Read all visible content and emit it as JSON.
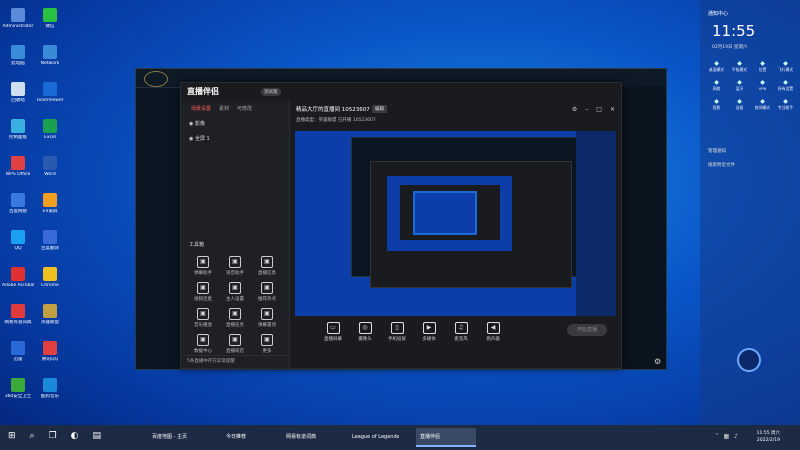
{
  "desktop_icons": [
    {
      "label": "Administrator",
      "color": "#5a8ad8"
    },
    {
      "label": "此电脑",
      "color": "#3a8cd8"
    },
    {
      "label": "回收站",
      "color": "#d0e0f0"
    },
    {
      "label": "控制面板",
      "color": "#3ab0e0"
    },
    {
      "label": "WPS Office",
      "color": "#e04040"
    },
    {
      "label": "百度网盘",
      "color": "#3a7ae0"
    },
    {
      "label": "QQ",
      "color": "#1aa0f0"
    },
    {
      "label": "Adobe Acrobat DC",
      "color": "#e03030"
    },
    {
      "label": "网易有道词典",
      "color": "#e03a3a"
    },
    {
      "label": "迅雷",
      "color": "#2a6ad8"
    },
    {
      "label": "360安全卫士",
      "color": "#3aaa3a"
    },
    {
      "label": "微信",
      "color": "#2ac040"
    },
    {
      "label": "Network",
      "color": "#3a8ad8"
    },
    {
      "label": "TeamViewer",
      "color": "#1a6ad8"
    },
    {
      "label": "Excel",
      "color": "#1aa050"
    },
    {
      "label": "Word",
      "color": "#2a5ab0"
    },
    {
      "label": "EV录屏",
      "color": "#f0a020"
    },
    {
      "label": "百度翻译",
      "color": "#3a6ad8"
    },
    {
      "label": "Chrome",
      "color": "#f0c020"
    },
    {
      "label": "英雄联盟",
      "color": "#c0a040"
    },
    {
      "label": "腾讯QQ",
      "color": "#e04040"
    },
    {
      "label": "酷狗音乐",
      "color": "#1a8ad8"
    }
  ],
  "live_window": {
    "app_name": "直播伴侣",
    "version": "测试版",
    "side_tabs": [
      "场景设置",
      "素材",
      "可修改"
    ],
    "scenes": [
      "影像",
      "全屏 1"
    ],
    "tools_title": "工具箱",
    "tools": [
      "弹幕助手",
      "语音助手",
      "直播信息",
      "视频连麦",
      "主人设置",
      "推荐热点",
      "音乐播放",
      "直播任务",
      "弹幕置顶",
      "数据中心",
      "直播商店",
      "更多"
    ],
    "footer": "5条直播中存在异常提醒",
    "room_title": "精品大厅的直播间 10523607",
    "room_edit": "编辑",
    "room_info": "直播类型：英雄联盟     已开播 10523607",
    "bottom_items": [
      "直播屏幕",
      "摄像头",
      "手机投屏",
      "多媒体",
      "麦克风",
      "扬声器"
    ],
    "start_button": "开始直播"
  },
  "action_center": {
    "title": "通知中心",
    "clock": "11:55",
    "date": "02月19日  星期六",
    "tiles": [
      "桌面模式",
      "平板模式",
      "位置",
      "飞行模式",
      "网络",
      "蓝牙",
      "VPN",
      "所有设置",
      "投影",
      "连接",
      "夜间模式",
      "专注助手"
    ],
    "links": [
      "管理通知",
      "搜索附近文件"
    ]
  },
  "taskbar": {
    "apps": [
      {
        "label": "百度地图 - 主页",
        "active": false
      },
      {
        "label": "今日推荐",
        "active": false
      },
      {
        "label": "网易有道词典",
        "active": false
      },
      {
        "label": "League of Legends",
        "active": false
      },
      {
        "label": "直播伴侣",
        "active": true
      }
    ],
    "time": "11:55 周六",
    "date": "2022/2/19"
  }
}
